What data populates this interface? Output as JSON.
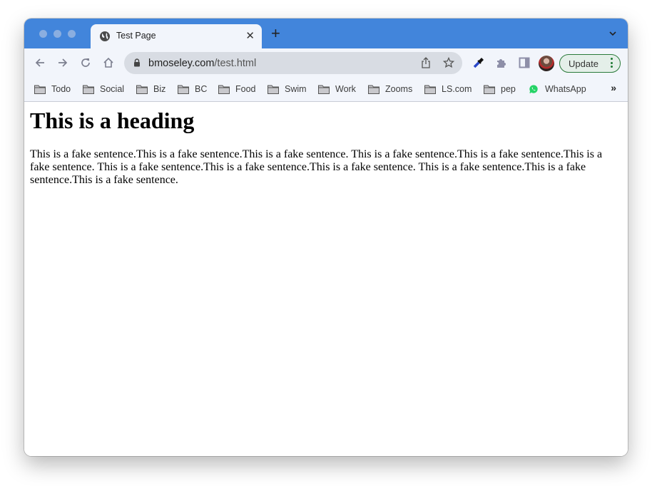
{
  "browser": {
    "tab": {
      "title": "Test Page",
      "icon": "globe-icon"
    },
    "new_tab_symbol": "+",
    "close_symbol": "✕",
    "address": {
      "domain": "bmoseley.com",
      "path": "/test.html"
    },
    "update_label": "Update",
    "bookmarks": [
      {
        "label": "Todo",
        "icon": "folder-icon"
      },
      {
        "label": "Social",
        "icon": "folder-icon"
      },
      {
        "label": "Biz",
        "icon": "folder-icon"
      },
      {
        "label": "BC",
        "icon": "folder-icon"
      },
      {
        "label": "Food",
        "icon": "folder-icon"
      },
      {
        "label": "Swim",
        "icon": "folder-icon"
      },
      {
        "label": "Work",
        "icon": "folder-icon"
      },
      {
        "label": "Zooms",
        "icon": "folder-icon"
      },
      {
        "label": "LS.com",
        "icon": "folder-icon"
      },
      {
        "label": "pep",
        "icon": "folder-icon"
      },
      {
        "label": "WhatsApp",
        "icon": "whatsapp-icon"
      }
    ],
    "bookmarks_overflow": "»",
    "colors": {
      "titlebar": "#4285db",
      "toolbar": "#f2f5fb",
      "update_border": "#2a7a3a",
      "whatsapp": "#25d366"
    }
  },
  "page": {
    "heading": "This is a heading",
    "paragraph": "This is a fake sentence.This is a fake sentence.This is a fake sentence. This is a fake sentence.This is a fake sentence.This is a fake sentence. This is a fake sentence.This is a fake sentence.This is a fake sentence. This is a fake sentence.This is a fake sentence.This is a fake sentence."
  }
}
